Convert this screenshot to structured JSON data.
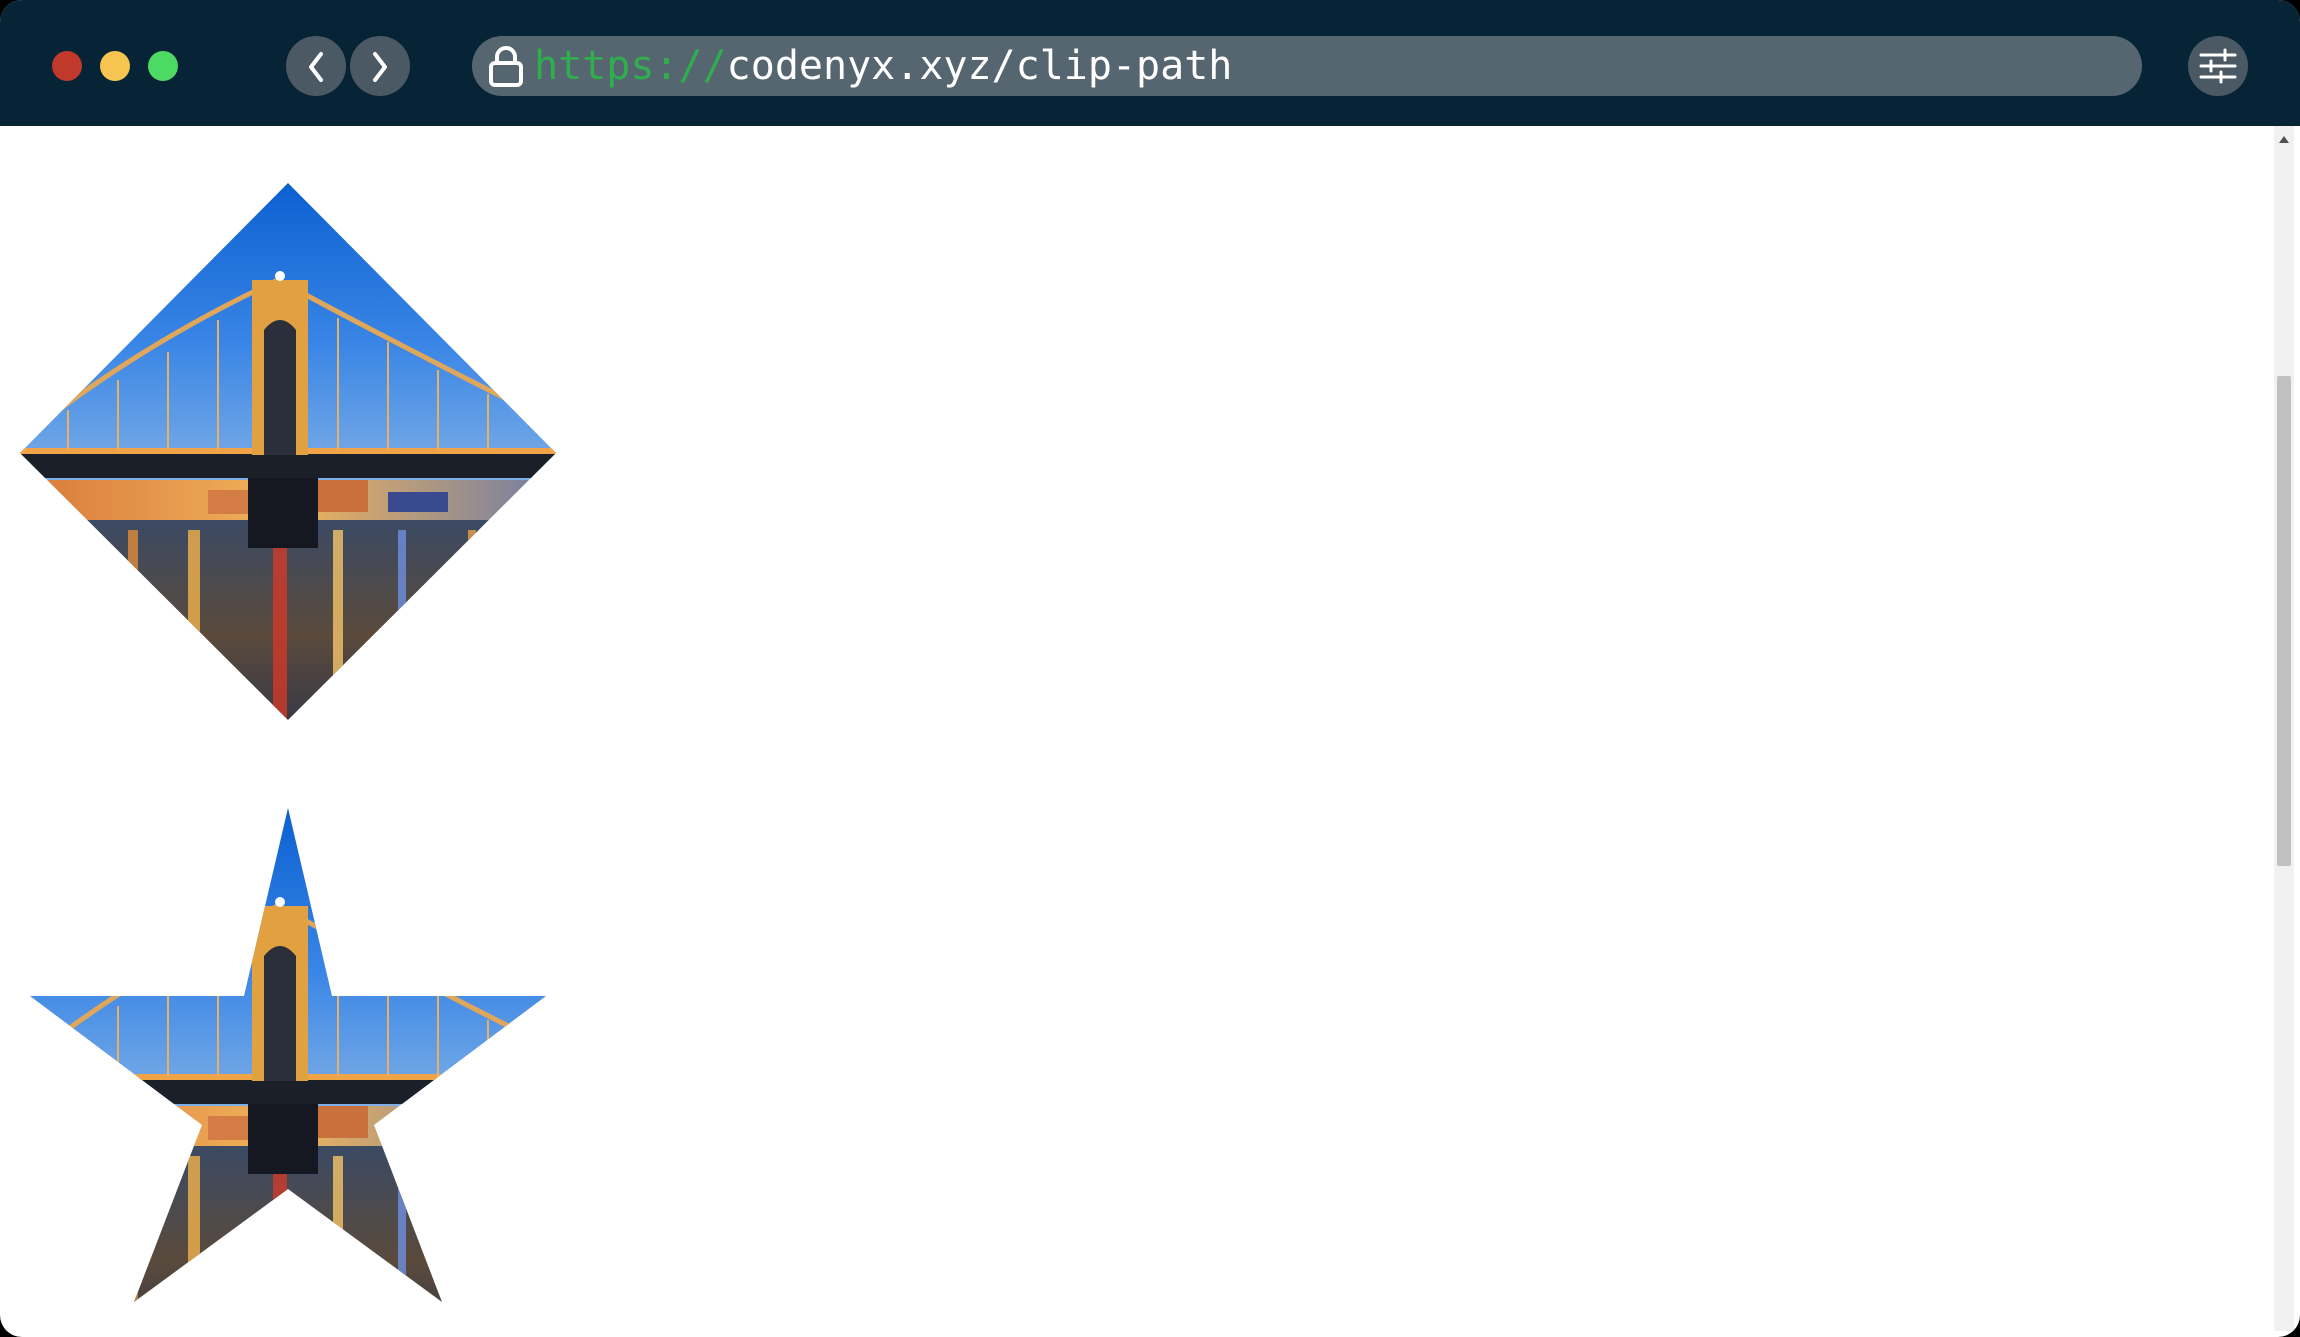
{
  "window": {
    "traffic_lights": [
      {
        "name": "close",
        "color": "#c0392b"
      },
      {
        "name": "minimize",
        "color": "#f5c451"
      },
      {
        "name": "maximize",
        "color": "#4cd964"
      }
    ]
  },
  "toolbar": {
    "back_icon": "chevron-left-icon",
    "forward_icon": "chevron-right-icon",
    "settings_icon": "sliders-icon"
  },
  "address_bar": {
    "lock_icon": "lock-icon",
    "url_scheme": "https://",
    "url_rest": "codenyx.xyz/clip-path"
  },
  "content": {
    "images": [
      {
        "shape": "diamond",
        "subject": "bridge-at-night-photo"
      },
      {
        "shape": "star",
        "subject": "bridge-at-night-photo"
      }
    ]
  },
  "colors": {
    "titlebar": "#062436",
    "urlbar": "#566670",
    "scheme_green": "#2fae4e",
    "page_background": "#ffffff"
  }
}
